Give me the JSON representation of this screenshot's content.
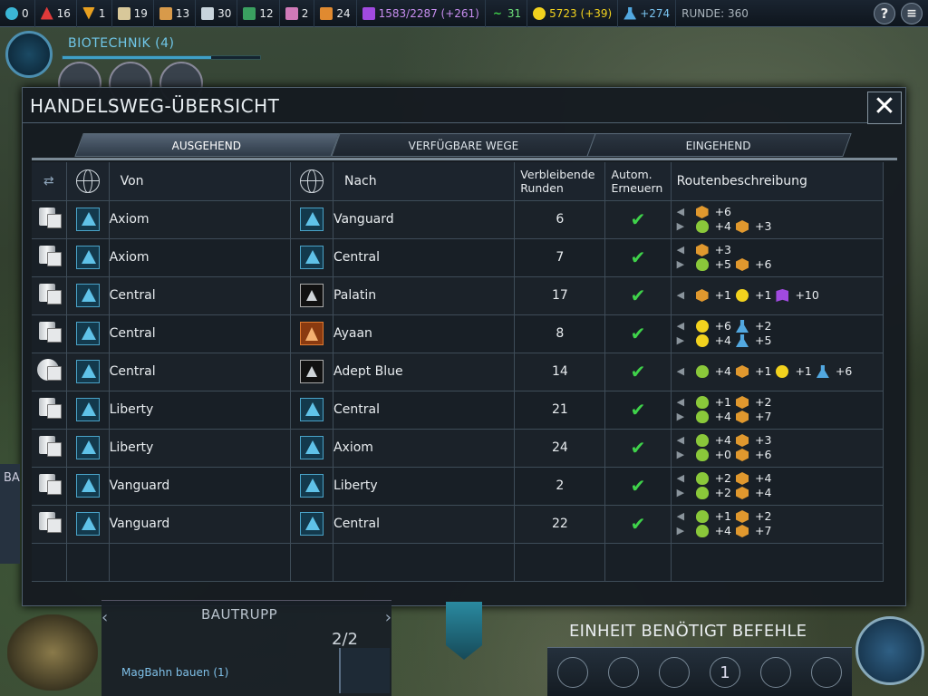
{
  "topbar": {
    "resources": [
      {
        "icon": "faith-icon",
        "value": "0",
        "color": "#3bb6d6"
      },
      {
        "icon": "military-icon",
        "value": "16",
        "color": "#e03a3a"
      },
      {
        "icon": "rank-icon",
        "value": "1",
        "color": "#e8a020"
      },
      {
        "icon": "firaxite-icon",
        "value": "19",
        "color": "#d8c89a"
      },
      {
        "icon": "geothermal-icon",
        "value": "13",
        "color": "#d89a4a"
      },
      {
        "icon": "titanium-icon",
        "value": "30",
        "color": "#c8d4dc"
      },
      {
        "icon": "floatstone-icon",
        "value": "12",
        "color": "#3aa060"
      },
      {
        "icon": "xenomass-icon",
        "value": "2",
        "color": "#d07ab8"
      },
      {
        "icon": "petroleum-icon",
        "value": "24",
        "color": "#e08a30"
      }
    ],
    "culture": "1583/2287 (+261)",
    "health": "31",
    "energy": "5723 (+39)",
    "science": "+274",
    "round": "RUNDE: 360"
  },
  "tech": {
    "name": "BIOTECHNIK (4)",
    "progress": 0.75
  },
  "modal": {
    "title": "HANDELSWEG-ÜBERSICHT",
    "tabs": [
      "AUSGEHEND",
      "VERFÜGBARE WEGE",
      "EINGEHEND"
    ],
    "active_tab": "AUSGEHEND",
    "headers": {
      "from": "Von",
      "to": "Nach",
      "turns": "Verbleibende Runden",
      "renew": "Autom. Erneuern",
      "desc": "Routenbeschreibung"
    },
    "rows": [
      {
        "unit": "cargo",
        "from": "Axiom",
        "to": "Vanguard",
        "to_affinity": "supremacy",
        "turns": "6",
        "renew": true,
        "lines": [
          {
            "dir": "in",
            "yields": [
              [
                "production",
                "+6"
              ]
            ]
          },
          {
            "dir": "out",
            "yields": [
              [
                "food",
                "+4"
              ],
              [
                "production",
                "+3"
              ]
            ]
          }
        ]
      },
      {
        "unit": "cargo",
        "from": "Axiom",
        "to": "Central",
        "to_affinity": "supremacy",
        "turns": "7",
        "renew": true,
        "lines": [
          {
            "dir": "in",
            "yields": [
              [
                "production",
                "+3"
              ]
            ]
          },
          {
            "dir": "out",
            "yields": [
              [
                "food",
                "+5"
              ],
              [
                "production",
                "+6"
              ]
            ]
          }
        ]
      },
      {
        "unit": "cargo",
        "from": "Central",
        "to": "Palatin",
        "to_affinity": "station",
        "turns": "17",
        "renew": true,
        "lines": [
          {
            "dir": "in",
            "yields": [
              [
                "production",
                "+1"
              ],
              [
                "energy",
                "+1"
              ],
              [
                "culture",
                "+10"
              ]
            ]
          }
        ]
      },
      {
        "unit": "cargo",
        "from": "Central",
        "to": "Ayaan",
        "to_affinity": "station-orange",
        "turns": "8",
        "renew": true,
        "lines": [
          {
            "dir": "in",
            "yields": [
              [
                "energy",
                "+6"
              ],
              [
                "science",
                "+2"
              ]
            ]
          },
          {
            "dir": "out",
            "yields": [
              [
                "energy",
                "+4"
              ],
              [
                "science",
                "+5"
              ]
            ]
          }
        ]
      },
      {
        "unit": "orbital",
        "from": "Central",
        "to": "Adept Blue",
        "to_affinity": "station",
        "turns": "14",
        "renew": true,
        "lines": [
          {
            "dir": "in",
            "yields": [
              [
                "food",
                "+4"
              ],
              [
                "production",
                "+1"
              ],
              [
                "energy",
                "+1"
              ],
              [
                "science",
                "+6"
              ]
            ]
          }
        ]
      },
      {
        "unit": "cargo",
        "from": "Liberty",
        "to": "Central",
        "to_affinity": "supremacy",
        "turns": "21",
        "renew": true,
        "lines": [
          {
            "dir": "in",
            "yields": [
              [
                "food",
                "+1"
              ],
              [
                "production",
                "+2"
              ]
            ]
          },
          {
            "dir": "out",
            "yields": [
              [
                "food",
                "+4"
              ],
              [
                "production",
                "+7"
              ]
            ]
          }
        ]
      },
      {
        "unit": "cargo",
        "from": "Liberty",
        "to": "Axiom",
        "to_affinity": "supremacy",
        "turns": "24",
        "renew": true,
        "lines": [
          {
            "dir": "in",
            "yields": [
              [
                "food",
                "+4"
              ],
              [
                "production",
                "+3"
              ]
            ]
          },
          {
            "dir": "out",
            "yields": [
              [
                "food",
                "+0"
              ],
              [
                "production",
                "+6"
              ]
            ]
          }
        ]
      },
      {
        "unit": "cargo",
        "from": "Vanguard",
        "to": "Liberty",
        "to_affinity": "supremacy",
        "turns": "2",
        "renew": true,
        "lines": [
          {
            "dir": "in",
            "yields": [
              [
                "food",
                "+2"
              ],
              [
                "production",
                "+4"
              ]
            ]
          },
          {
            "dir": "out",
            "yields": [
              [
                "food",
                "+2"
              ],
              [
                "production",
                "+4"
              ]
            ]
          }
        ]
      },
      {
        "unit": "cargo",
        "from": "Vanguard",
        "to": "Central",
        "to_affinity": "supremacy",
        "turns": "22",
        "renew": true,
        "lines": [
          {
            "dir": "in",
            "yields": [
              [
                "food",
                "+1"
              ],
              [
                "production",
                "+2"
              ]
            ]
          },
          {
            "dir": "out",
            "yields": [
              [
                "food",
                "+4"
              ],
              [
                "production",
                "+7"
              ]
            ]
          }
        ]
      }
    ]
  },
  "bottom": {
    "unit_name": "BAUTRUPP",
    "page": "2/2",
    "command": "MagBahn bauen (1)",
    "needs_orders": "EINHEIT BENÖTIGT BEFEHLE",
    "action_count": "1",
    "side_label": "BA"
  }
}
